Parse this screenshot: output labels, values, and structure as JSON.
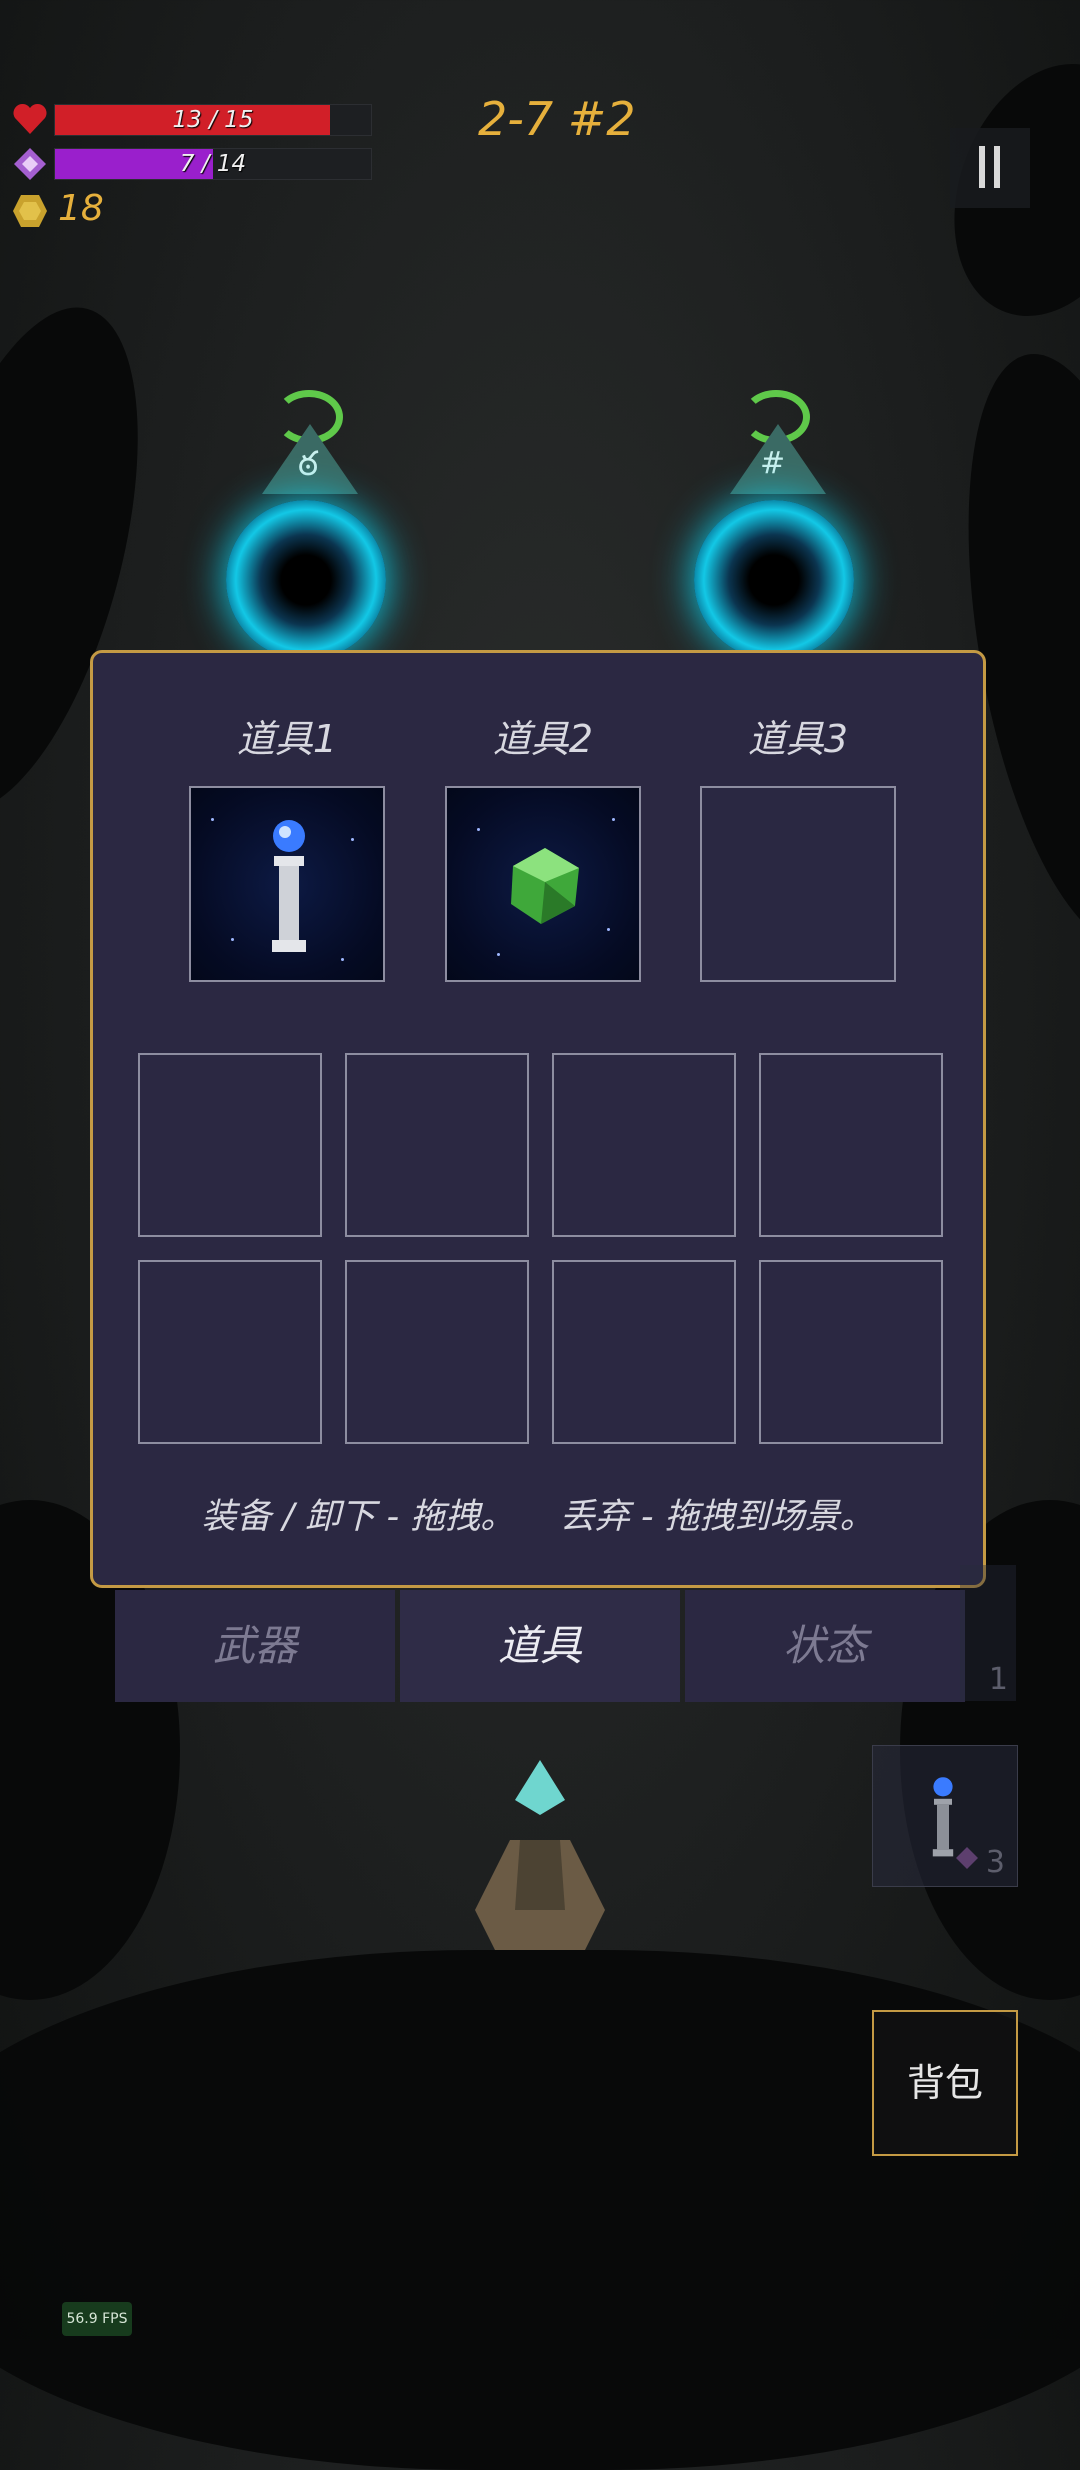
{
  "hud": {
    "health": {
      "text": "13 / 15",
      "current": 13,
      "max": 15,
      "color": "#d11f28",
      "icon": "heart-icon"
    },
    "mana": {
      "text": "7 / 14",
      "current": 7,
      "max": 14,
      "color": "#9a1fcc",
      "icon": "mana-crystal-icon"
    },
    "coins": {
      "value": "18",
      "icon": "coin-icon"
    },
    "level": "2-7 #2"
  },
  "inventory": {
    "equip_labels": [
      "道具1",
      "道具2",
      "道具3"
    ],
    "equip_items": [
      "crystal-pillar-icon",
      "green-gem-icon",
      ""
    ],
    "hint": "装备 / 卸下 - 拖拽。    丢弃 - 拖拽到场景。",
    "tabs": [
      {
        "label": "武器",
        "active": false
      },
      {
        "label": "道具",
        "active": true
      },
      {
        "label": "状态",
        "active": false
      }
    ]
  },
  "side_slots": [
    {
      "count": "1"
    },
    {
      "count": "3"
    }
  ],
  "bag_button": "背包",
  "fps": "56.9 FPS",
  "colors": {
    "accent": "#e6b03c",
    "panel": "#2b2842",
    "panel_border": "#c49a44"
  }
}
